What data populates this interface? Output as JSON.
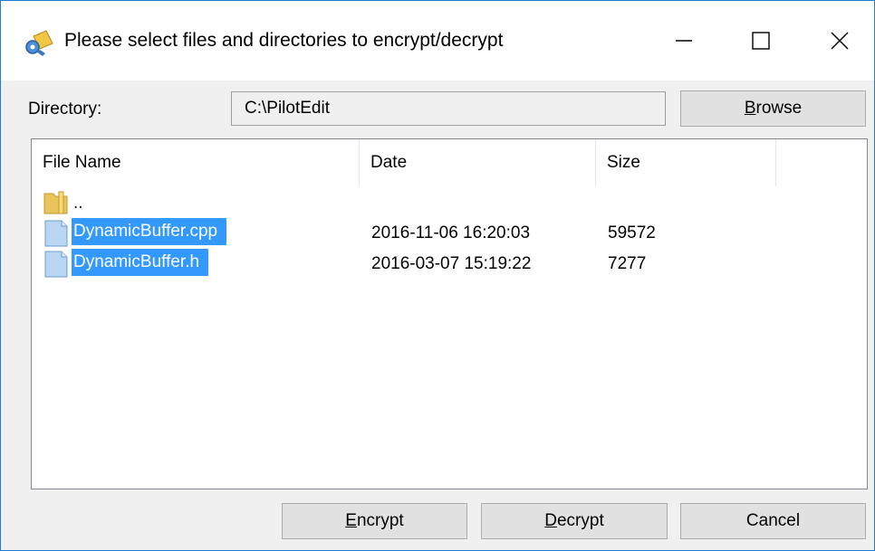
{
  "window": {
    "title": "Please select files and directories to encrypt/decrypt",
    "accent_color": "#1f7ad6"
  },
  "directory": {
    "label": "Directory:",
    "value": "C:\\PilotEdit"
  },
  "buttons": {
    "browse": {
      "prefix": "",
      "mnemonic": "B",
      "rest": "rowse"
    },
    "encrypt": {
      "prefix": "",
      "mnemonic": "E",
      "rest": "ncrypt"
    },
    "decrypt": {
      "prefix": "",
      "mnemonic": "D",
      "rest": "ecrypt"
    },
    "cancel": {
      "label": "Cancel"
    }
  },
  "columns": {
    "name": "File Name",
    "date": "Date",
    "size": "Size"
  },
  "rows": [
    {
      "icon": "folder-icon",
      "name": "..",
      "date": "",
      "size": "",
      "selected": false
    },
    {
      "icon": "file-icon",
      "name": "DynamicBuffer.cpp",
      "date": "2016-11-06 16:20:03",
      "size": "59572",
      "selected": true
    },
    {
      "icon": "file-icon",
      "name": "DynamicBuffer.h",
      "date": "2016-03-07 15:19:22",
      "size": "7277",
      "selected": true
    }
  ],
  "colors": {
    "selection": "#3399ff",
    "button_face": "#e1e1e1",
    "dialog_background": "#f0f0f0"
  }
}
